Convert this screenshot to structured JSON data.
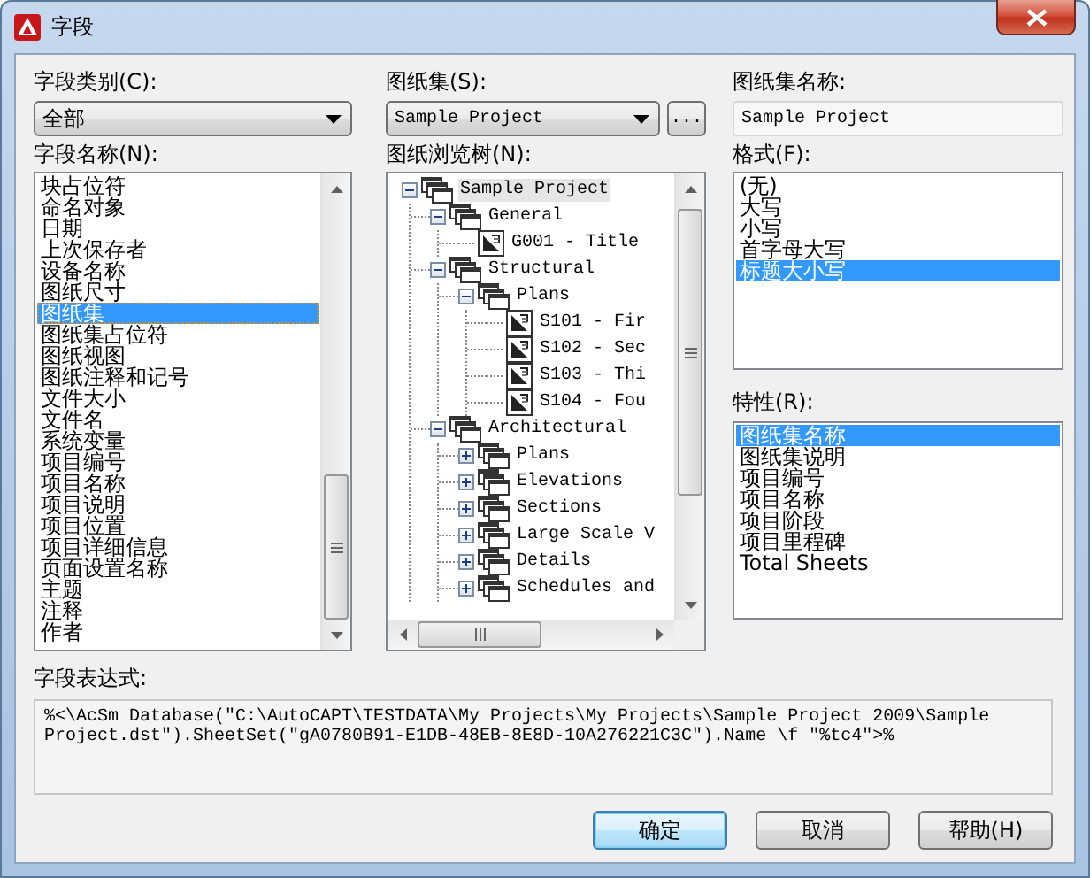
{
  "window": {
    "title": "字段"
  },
  "field_category": {
    "label": "字段类别(C):",
    "value": "全部"
  },
  "field_names": {
    "label": "字段名称(N):",
    "items": [
      {
        "label": "块占位符",
        "selected": false
      },
      {
        "label": "命名对象",
        "selected": false
      },
      {
        "label": "日期",
        "selected": false
      },
      {
        "label": "上次保存者",
        "selected": false
      },
      {
        "label": "设备名称",
        "selected": false
      },
      {
        "label": "图纸尺寸",
        "selected": false
      },
      {
        "label": "图纸集",
        "selected": true
      },
      {
        "label": "图纸集占位符",
        "selected": false
      },
      {
        "label": "图纸视图",
        "selected": false
      },
      {
        "label": "图纸注释和记号",
        "selected": false
      },
      {
        "label": "文件大小",
        "selected": false
      },
      {
        "label": "文件名",
        "selected": false
      },
      {
        "label": "系统变量",
        "selected": false
      },
      {
        "label": "项目编号",
        "selected": false
      },
      {
        "label": "项目名称",
        "selected": false
      },
      {
        "label": "项目说明",
        "selected": false
      },
      {
        "label": "项目位置",
        "selected": false
      },
      {
        "label": "项目详细信息",
        "selected": false
      },
      {
        "label": "页面设置名称",
        "selected": false
      },
      {
        "label": "主题",
        "selected": false
      },
      {
        "label": "注释",
        "selected": false
      },
      {
        "label": "作者",
        "selected": false
      }
    ]
  },
  "sheet_set": {
    "label": "图纸集(S):",
    "value": "Sample Project",
    "browse_button": "..."
  },
  "sheet_tree": {
    "label": "图纸浏览树(N):",
    "nodes": [
      {
        "label": "Sample Project",
        "kind": "set",
        "expanded": true,
        "selected": true,
        "children": [
          {
            "label": "General",
            "kind": "subset",
            "expanded": true,
            "selected": false,
            "children": [
              {
                "label": "G001 - Title",
                "kind": "sheet",
                "selected": false
              }
            ]
          },
          {
            "label": "Structural",
            "kind": "subset",
            "expanded": true,
            "selected": false,
            "children": [
              {
                "label": "Plans",
                "kind": "subset",
                "expanded": true,
                "selected": false,
                "children": [
                  {
                    "label": "S101 - Fir",
                    "kind": "sheet",
                    "selected": false
                  },
                  {
                    "label": "S102 - Sec",
                    "kind": "sheet",
                    "selected": false
                  },
                  {
                    "label": "S103 - Thi",
                    "kind": "sheet",
                    "selected": false
                  },
                  {
                    "label": "S104 - Fou",
                    "kind": "sheet",
                    "selected": false
                  }
                ]
              }
            ]
          },
          {
            "label": "Architectural",
            "kind": "subset",
            "expanded": true,
            "selected": false,
            "children": [
              {
                "label": "Plans",
                "kind": "subset",
                "expanded": false,
                "selected": false
              },
              {
                "label": "Elevations",
                "kind": "subset",
                "expanded": false,
                "selected": false
              },
              {
                "label": "Sections",
                "kind": "subset",
                "expanded": false,
                "selected": false
              },
              {
                "label": "Large Scale V",
                "kind": "subset",
                "expanded": false,
                "selected": false
              },
              {
                "label": "Details",
                "kind": "subset",
                "expanded": false,
                "selected": false
              },
              {
                "label": "Schedules and",
                "kind": "subset",
                "expanded": false,
                "selected": false
              }
            ]
          }
        ]
      }
    ]
  },
  "sheet_set_name": {
    "label": "图纸集名称:",
    "value": "Sample Project"
  },
  "format": {
    "label": "格式(F):",
    "items": [
      {
        "label": "(无)",
        "selected": false
      },
      {
        "label": "大写",
        "selected": false
      },
      {
        "label": "小写",
        "selected": false
      },
      {
        "label": "首字母大写",
        "selected": false
      },
      {
        "label": "标题大小写",
        "selected": true
      }
    ]
  },
  "properties": {
    "label": "特性(R):",
    "items": [
      {
        "label": "图纸集名称",
        "selected": true
      },
      {
        "label": "图纸集说明",
        "selected": false
      },
      {
        "label": "项目编号",
        "selected": false
      },
      {
        "label": "项目名称",
        "selected": false
      },
      {
        "label": "项目阶段",
        "selected": false
      },
      {
        "label": "项目里程碑",
        "selected": false
      },
      {
        "label": "Total Sheets",
        "selected": false
      }
    ]
  },
  "expression": {
    "label": "字段表达式:",
    "value": "%<\\AcSm Database(\"C:\\AutoCAPT\\TESTDATA\\My Projects\\My Projects\\Sample Project 2009\\Sample Project.dst\").SheetSet(\"gA0780B91-E1DB-48EB-8E8D-10A276221C3C\").Name \\f \"%tc4\">%"
  },
  "buttons": [
    {
      "label": "确定",
      "default": true
    },
    {
      "label": "取消",
      "default": false
    },
    {
      "label": "帮助(H)",
      "default": false
    }
  ]
}
